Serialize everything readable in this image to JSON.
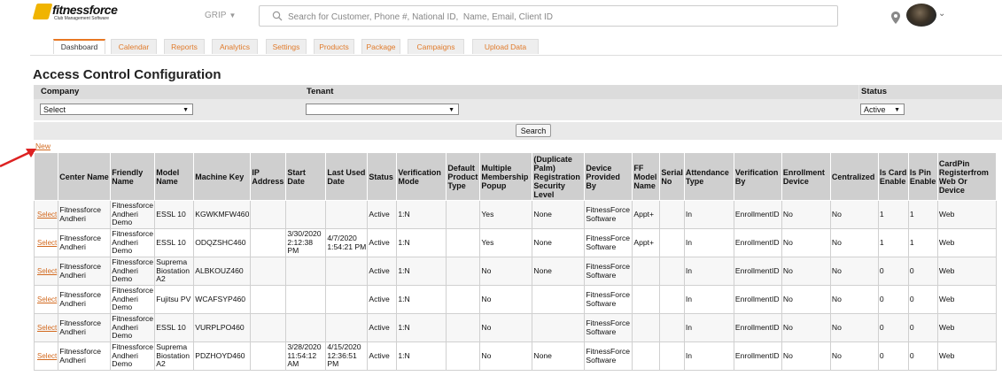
{
  "brand": {
    "name": "fitnessforce",
    "tagline": "Club Management Software"
  },
  "header": {
    "location_label": "GRIP",
    "search_placeholder": "Search for Customer, Phone #, National ID,  Name, Email, Client ID"
  },
  "tabs": [
    {
      "label": "Dashboard",
      "active": true
    },
    {
      "label": "Calendar",
      "active": false
    },
    {
      "label": "Reports",
      "active": false
    },
    {
      "label": "Analytics",
      "active": false
    },
    {
      "label": "Settings",
      "active": false
    },
    {
      "label": "Products",
      "active": false
    },
    {
      "label": "Package",
      "active": false
    },
    {
      "label": "Campaigns",
      "active": false
    },
    {
      "label": "Upload Data",
      "active": false
    }
  ],
  "page_title": "Access Control Configuration",
  "filters": {
    "company_label": "Company",
    "company_value": "Select",
    "tenant_label": "Tenant",
    "tenant_value": "",
    "status_label": "Status",
    "status_value": "Active",
    "search_button": "Search"
  },
  "new_link": "New",
  "table": {
    "columns": [
      "",
      "Center Name",
      "Friendly Name",
      "Model Name",
      "Machine Key",
      "IP Address",
      "Start Date",
      "Last Used Date",
      "Status",
      "Verification Mode",
      "Default Product Type",
      "Multiple Membership Popup",
      "(Duplicate Palm) Registration Security Level",
      "Device Provided By",
      "FF Model Name",
      "Serial No",
      "Attendance Type",
      "Verification By",
      "Enrollment Device",
      "Centralized",
      "Is Card Enable",
      "Is Pin Enable",
      "CardPin Registerfrom Web Or Device"
    ],
    "select_label": "Select",
    "rows": [
      [
        "Select",
        "Fitnessforce Andheri",
        "Fitnessforce Andheri Demo",
        "ESSL 10",
        "KGWKMFW460",
        "",
        "",
        "",
        "Active",
        "1:N",
        "",
        "Yes",
        "None",
        "FitnessForce Software",
        "Appt+",
        "",
        "In",
        "EnrollmentID",
        "No",
        "No",
        "1",
        "1",
        "Web"
      ],
      [
        "Select",
        "Fitnessforce Andheri",
        "Fitnessforce Andheri Demo",
        "ESSL 10",
        "ODQZSHC460",
        "",
        "3/30/2020 2:12:38 PM",
        "4/7/2020 1:54:21 PM",
        "Active",
        "1:N",
        "",
        "Yes",
        "None",
        "FitnessForce Software",
        "Appt+",
        "",
        "In",
        "EnrollmentID",
        "No",
        "No",
        "1",
        "1",
        "Web"
      ],
      [
        "Select",
        "Fitnessforce Andheri",
        "Fitnessforce Andheri Demo",
        "Suprema Biostation A2",
        "ALBKOUZ460",
        "",
        "",
        "",
        "Active",
        "1:N",
        "",
        "No",
        "None",
        "FitnessForce Software",
        "",
        "",
        "In",
        "EnrollmentID",
        "No",
        "No",
        "0",
        "0",
        "Web"
      ],
      [
        "Select",
        "Fitnessforce Andheri",
        "Fitnessforce Andheri Demo",
        "Fujitsu PV",
        "WCAFSYP460",
        "",
        "",
        "",
        "Active",
        "1:N",
        "",
        "No",
        "",
        "FitnessForce Software",
        "",
        "",
        "In",
        "EnrollmentID",
        "No",
        "No",
        "0",
        "0",
        "Web"
      ],
      [
        "Select",
        "Fitnessforce Andheri",
        "Fitnessforce Andheri Demo",
        "ESSL 10",
        "VURPLPO460",
        "",
        "",
        "",
        "Active",
        "1:N",
        "",
        "No",
        "",
        "FitnessForce Software",
        "",
        "",
        "In",
        "EnrollmentID",
        "No",
        "No",
        "0",
        "0",
        "Web"
      ],
      [
        "Select",
        "Fitnessforce Andheri",
        "Fitnessforce Andheri Demo",
        "Suprema Biostation A2",
        "PDZHOYD460",
        "",
        "3/28/2020 11:54:12 AM",
        "4/15/2020 12:36:51 PM",
        "Active",
        "1:N",
        "",
        "No",
        "None",
        "FitnessForce Software",
        "",
        "",
        "In",
        "EnrollmentID",
        "No",
        "No",
        "0",
        "0",
        "Web"
      ]
    ]
  }
}
